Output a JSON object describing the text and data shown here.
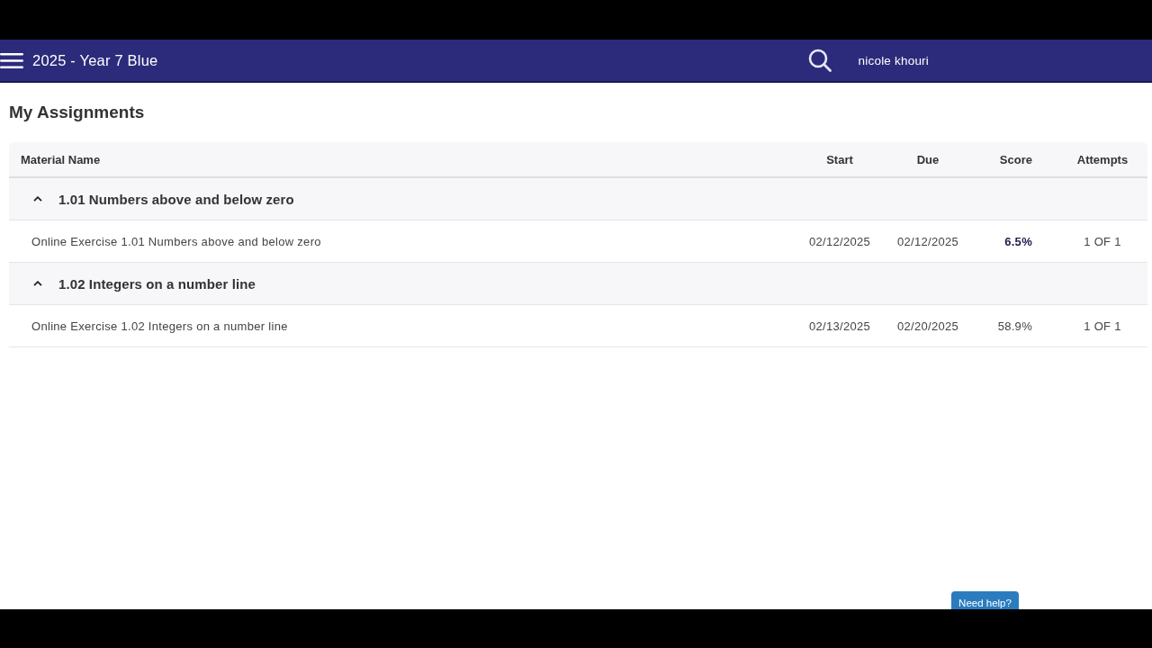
{
  "header": {
    "title": "2025 - Year 7 Blue",
    "user": "nicole khouri"
  },
  "page_title": "My Assignments",
  "table": {
    "columns": [
      "Material Name",
      "Start",
      "Due",
      "Score",
      "Attempts"
    ],
    "groups": [
      {
        "title": "1.01 Numbers above and below zero",
        "expanded": true,
        "rows": [
          {
            "name": "Online Exercise 1.01 Numbers above and below zero",
            "start": "02/12/2025",
            "due": "02/12/2025",
            "score": "6.5%",
            "score_highlighted": true,
            "attempts": "1 OF 1"
          }
        ]
      },
      {
        "title": "1.02 Integers on a number line",
        "expanded": true,
        "rows": [
          {
            "name": "Online Exercise 1.02 Integers on a number line",
            "start": "02/13/2025",
            "due": "02/20/2025",
            "score": "58.9%",
            "score_highlighted": false,
            "attempts": "1 OF 1"
          }
        ]
      }
    ]
  },
  "help_button": "Need help?"
}
